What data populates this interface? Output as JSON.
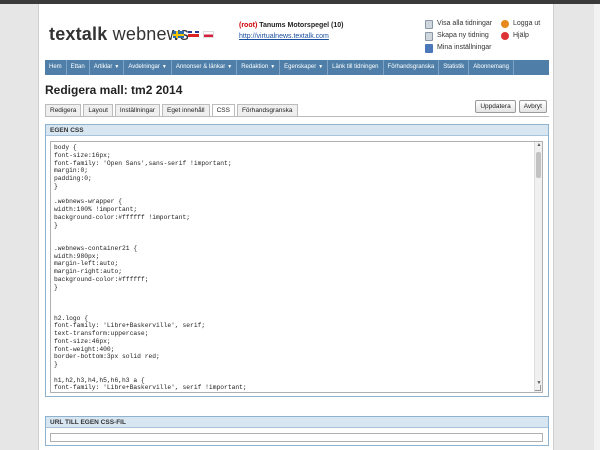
{
  "header": {
    "logo_bold": "texta",
    "logo_mid": "lk",
    "logo_rest": " webnews",
    "site_root": "(root)",
    "site_name": "Tanums Motorspegel (10)",
    "site_url": "http://virtualnews.textalk.com"
  },
  "header_links": {
    "view_all": "Visa alla tidningar",
    "create_new": "Skapa ny tidning",
    "my_settings": "Mina inställningar",
    "logout": "Logga ut",
    "help": "Hjälp"
  },
  "nav": [
    {
      "label": "Hem",
      "dropdown": false
    },
    {
      "label": "Ettan",
      "dropdown": false
    },
    {
      "label": "Artiklar",
      "dropdown": true
    },
    {
      "label": "Avdelningar",
      "dropdown": true
    },
    {
      "label": "Annonser & länkar",
      "dropdown": true
    },
    {
      "label": "Redaktion",
      "dropdown": true
    },
    {
      "label": "Egenskaper",
      "dropdown": true
    },
    {
      "label": "Länk till tidningen",
      "dropdown": false
    },
    {
      "label": "Förhandsgranska",
      "dropdown": false
    },
    {
      "label": "Statistik",
      "dropdown": false
    },
    {
      "label": "Abonnemang",
      "dropdown": false
    }
  ],
  "page_title": "Redigera mall: tm2 2014",
  "tabs": [
    "Redigera",
    "Layout",
    "Inställningar",
    "Eget innehåll",
    "CSS",
    "Förhandsgranska"
  ],
  "active_tab": "CSS",
  "actions": {
    "update": "Uppdatera",
    "cancel": "Avbryt"
  },
  "css_panel": {
    "title": "EGEN CSS",
    "code": "body {\nfont-size:16px;\nfont-family: 'Open Sans',sans-serif !important;\nmargin:0;\npadding:0;\n}\n\n.webnews-wrapper {\nwidth:100% !important;\nbackground-color:#ffffff !important;\n}\n\n\n.webnews-container21 {\nwidth:980px;\nmargin-left:auto;\nmargin-right:auto;\nbackground-color:#ffffff;\n}\n\n\n\nh2.logo {\nfont-family: 'Libre+Baskerville', serif;\ntext-transform:uppercase;\nfont-size:46px;\nfont-weight:400;\nborder-bottom:3px solid red;\n}\n\nh1,h2,h3,h4,h5,h6,h3 a {\nfont-family: 'Libre+Baskerville', serif !important;\n}"
  },
  "url_panel": {
    "title": "URL TILL EGEN CSS-FIL",
    "value": ""
  },
  "icons": {
    "view_all": "document-icon",
    "create_new": "document-icon",
    "my_settings": "user-icon",
    "logout": "power-icon",
    "help": "help-icon"
  }
}
